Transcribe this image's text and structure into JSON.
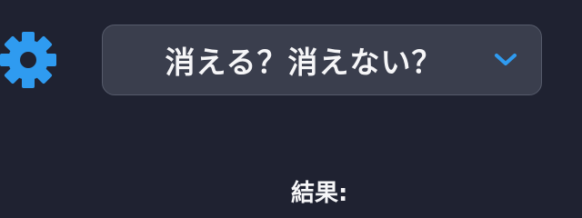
{
  "settings": {
    "icon": "gear-icon",
    "color": "#2f9bf0"
  },
  "selector": {
    "selected_value": "消える？消えない？",
    "chevron_icon": "chevron-down-icon",
    "chevron_color": "#2f9bf0"
  },
  "result": {
    "label": "結果:"
  }
}
